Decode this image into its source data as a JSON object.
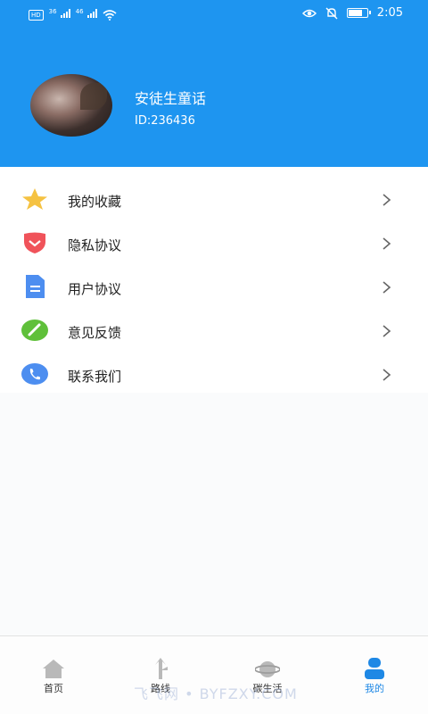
{
  "status_bar": {
    "hd_badge": "HD",
    "sim1_net": "36",
    "sim2_net": "46",
    "time": "2:05"
  },
  "profile": {
    "username": "安徒生童话",
    "user_id": "ID:236436"
  },
  "menu": {
    "items": [
      {
        "label": "我的收藏",
        "icon": "star-icon",
        "color": "#f5c242"
      },
      {
        "label": "隐私协议",
        "icon": "shield-icon",
        "color": "#f0535a"
      },
      {
        "label": "用户协议",
        "icon": "document-icon",
        "color": "#4d8ef0"
      },
      {
        "label": "意见反馈",
        "icon": "pencil-icon",
        "color": "#5fc03a"
      },
      {
        "label": "联系我们",
        "icon": "phone-icon",
        "color": "#4d8ef0"
      }
    ]
  },
  "tabbar": {
    "tabs": [
      {
        "label": "首页",
        "icon": "home-icon"
      },
      {
        "label": "路线",
        "icon": "route-icon"
      },
      {
        "label": "碳生活",
        "icon": "planet-icon"
      },
      {
        "label": "我的",
        "icon": "user-icon",
        "active": true
      }
    ]
  },
  "watermark": "飞飞网 • BYFZXY.COM",
  "colors": {
    "header_blue": "#1e95f0",
    "active_tab": "#1e88e5",
    "inactive_icon": "#b9b9b9"
  },
  "battery_level": 0.7
}
